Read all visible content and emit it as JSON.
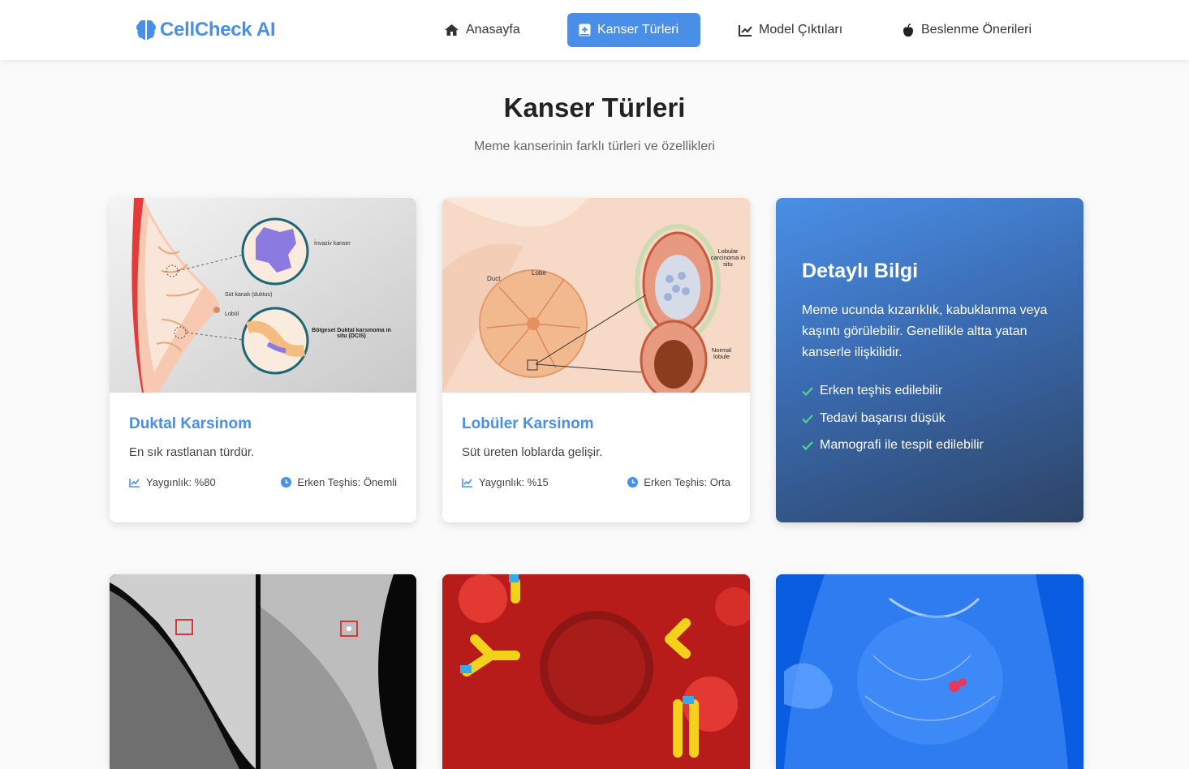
{
  "brand": {
    "name": "CellCheck AI",
    "icon": "brain-icon"
  },
  "nav": [
    {
      "label": "Anasayfa",
      "icon": "home-icon",
      "active": false
    },
    {
      "label": "Kanser Türleri",
      "icon": "plus-book-icon",
      "active": true
    },
    {
      "label": "Model Çıktıları",
      "icon": "chart-line-icon",
      "active": false
    },
    {
      "label": "Beslenme Önerileri",
      "icon": "apple-icon",
      "active": false
    }
  ],
  "page": {
    "title": "Kanser Türleri",
    "subtitle": "Meme kanserinin farklı türleri ve özellikleri"
  },
  "cards": [
    {
      "title": "Duktal Karsinom",
      "description": "En sık rastlanan türdür.",
      "prevalence": "Yaygınlık: %80",
      "early_diagnosis": "Erken Teşhis: Önemli",
      "image_labels": {
        "invasive": "İnvaziv kanser",
        "duct": "Süt kanalı (duktus)",
        "lobule": "Lobül",
        "dcis": "Bölgesel Duktal karsinoma in situ (DCIS)"
      }
    },
    {
      "title": "Lobüler Karsinom",
      "description": "Süt üreten loblarda gelişir.",
      "prevalence": "Yaygınlık: %15",
      "early_diagnosis": "Erken Teşhis: Orta",
      "image_labels": {
        "duct": "Duct",
        "lobe": "Lobe",
        "lcis": "Lobular carcinoma in situ",
        "normal": "Normal lobule"
      }
    }
  ],
  "info": {
    "title": "Detaylı Bilgi",
    "text": "Meme ucunda kızarıklık, kabuklanma veya kaşıntı görülebilir. Genellikle altta yatan kanserle ilişkilidir.",
    "items": [
      "Erken teşhis edilebilir",
      "Tedavi başarısı düşük",
      "Mamografi ile tespit edilebilir"
    ]
  },
  "colors": {
    "accent": "#4a8fe7",
    "check": "#4cd98a"
  }
}
